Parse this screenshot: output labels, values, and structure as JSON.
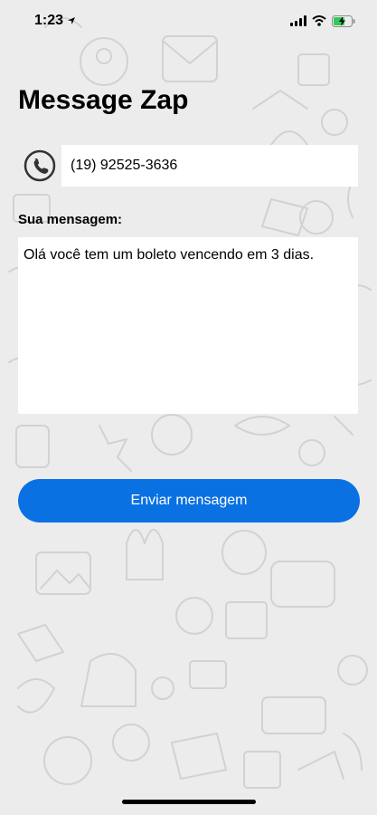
{
  "status_bar": {
    "time": "1:23",
    "icons": [
      "location-arrow-icon",
      "signal-icon",
      "wifi-icon",
      "battery-charging-icon"
    ]
  },
  "app": {
    "title": "Message Zap"
  },
  "form": {
    "phone_icon": "phone-icon",
    "phone_value": "(19) 92525-3636",
    "message_label": "Sua mensagem:",
    "message_value": "Olá você tem um boleto vencendo em 3 dias."
  },
  "actions": {
    "send_label": "Enviar mensagem"
  },
  "colors": {
    "accent": "#0a71e3",
    "background": "#ececec",
    "field": "#ffffff"
  }
}
